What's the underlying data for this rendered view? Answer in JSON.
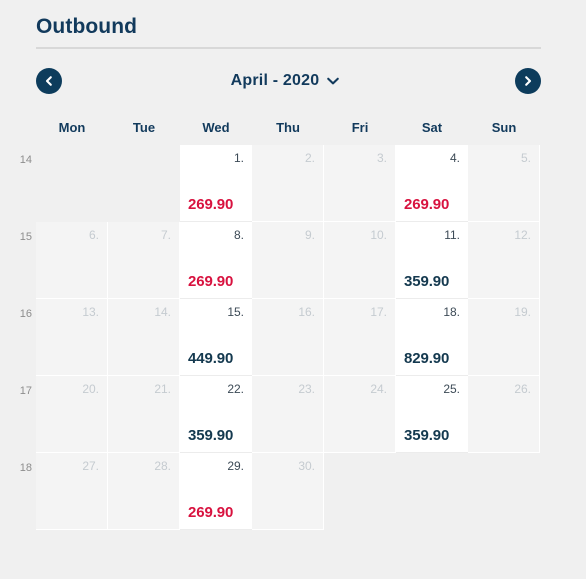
{
  "panel": {
    "title": "Outbound"
  },
  "nav": {
    "prev_icon": "chevron-left-icon",
    "next_icon": "chevron-right-icon",
    "prev_label": "Previous month",
    "next_label": "Next month",
    "month_label": "April - 2020",
    "dropdown_icon": "chevron-down-icon"
  },
  "weekdays": [
    "Mon",
    "Tue",
    "Wed",
    "Thu",
    "Fri",
    "Sat",
    "Sun"
  ],
  "colors": {
    "page_background": "#f0f0f0",
    "title": "#123a5c",
    "accent_navy": "#0d3c5c",
    "price_red": "#d8123f",
    "price_navy": "#14394f",
    "disabled_cell": "#f4f4f4",
    "active_cell": "#ffffff",
    "disabled_day": "#c5cbd0",
    "active_day": "#3c4a56",
    "rule": "#d8d8d8"
  },
  "weeks": [
    {
      "week_number": "14",
      "days": [
        {
          "state": "empty",
          "day": "",
          "price": "",
          "price_color": ""
        },
        {
          "state": "empty",
          "day": "",
          "price": "",
          "price_color": ""
        },
        {
          "state": "active",
          "day": "1.",
          "price": "269.90",
          "price_color": "red"
        },
        {
          "state": "disabled",
          "day": "2.",
          "price": "",
          "price_color": ""
        },
        {
          "state": "disabled",
          "day": "3.",
          "price": "",
          "price_color": ""
        },
        {
          "state": "active",
          "day": "4.",
          "price": "269.90",
          "price_color": "red"
        },
        {
          "state": "disabled",
          "day": "5.",
          "price": "",
          "price_color": ""
        }
      ]
    },
    {
      "week_number": "15",
      "days": [
        {
          "state": "disabled",
          "day": "6.",
          "price": "",
          "price_color": ""
        },
        {
          "state": "disabled",
          "day": "7.",
          "price": "",
          "price_color": ""
        },
        {
          "state": "active",
          "day": "8.",
          "price": "269.90",
          "price_color": "red"
        },
        {
          "state": "disabled",
          "day": "9.",
          "price": "",
          "price_color": ""
        },
        {
          "state": "disabled",
          "day": "10.",
          "price": "",
          "price_color": ""
        },
        {
          "state": "active",
          "day": "11.",
          "price": "359.90",
          "price_color": "navy"
        },
        {
          "state": "disabled",
          "day": "12.",
          "price": "",
          "price_color": ""
        }
      ]
    },
    {
      "week_number": "16",
      "days": [
        {
          "state": "disabled",
          "day": "13.",
          "price": "",
          "price_color": ""
        },
        {
          "state": "disabled",
          "day": "14.",
          "price": "",
          "price_color": ""
        },
        {
          "state": "active",
          "day": "15.",
          "price": "449.90",
          "price_color": "navy"
        },
        {
          "state": "disabled",
          "day": "16.",
          "price": "",
          "price_color": ""
        },
        {
          "state": "disabled",
          "day": "17.",
          "price": "",
          "price_color": ""
        },
        {
          "state": "active",
          "day": "18.",
          "price": "829.90",
          "price_color": "navy"
        },
        {
          "state": "disabled",
          "day": "19.",
          "price": "",
          "price_color": ""
        }
      ]
    },
    {
      "week_number": "17",
      "days": [
        {
          "state": "disabled",
          "day": "20.",
          "price": "",
          "price_color": ""
        },
        {
          "state": "disabled",
          "day": "21.",
          "price": "",
          "price_color": ""
        },
        {
          "state": "active",
          "day": "22.",
          "price": "359.90",
          "price_color": "navy"
        },
        {
          "state": "disabled",
          "day": "23.",
          "price": "",
          "price_color": ""
        },
        {
          "state": "disabled",
          "day": "24.",
          "price": "",
          "price_color": ""
        },
        {
          "state": "active",
          "day": "25.",
          "price": "359.90",
          "price_color": "navy"
        },
        {
          "state": "disabled",
          "day": "26.",
          "price": "",
          "price_color": ""
        }
      ]
    },
    {
      "week_number": "18",
      "days": [
        {
          "state": "disabled",
          "day": "27.",
          "price": "",
          "price_color": ""
        },
        {
          "state": "disabled",
          "day": "28.",
          "price": "",
          "price_color": ""
        },
        {
          "state": "active",
          "day": "29.",
          "price": "269.90",
          "price_color": "red"
        },
        {
          "state": "disabled",
          "day": "30.",
          "price": "",
          "price_color": ""
        },
        {
          "state": "empty",
          "day": "",
          "price": "",
          "price_color": ""
        },
        {
          "state": "empty",
          "day": "",
          "price": "",
          "price_color": ""
        },
        {
          "state": "empty",
          "day": "",
          "price": "",
          "price_color": ""
        }
      ]
    }
  ]
}
